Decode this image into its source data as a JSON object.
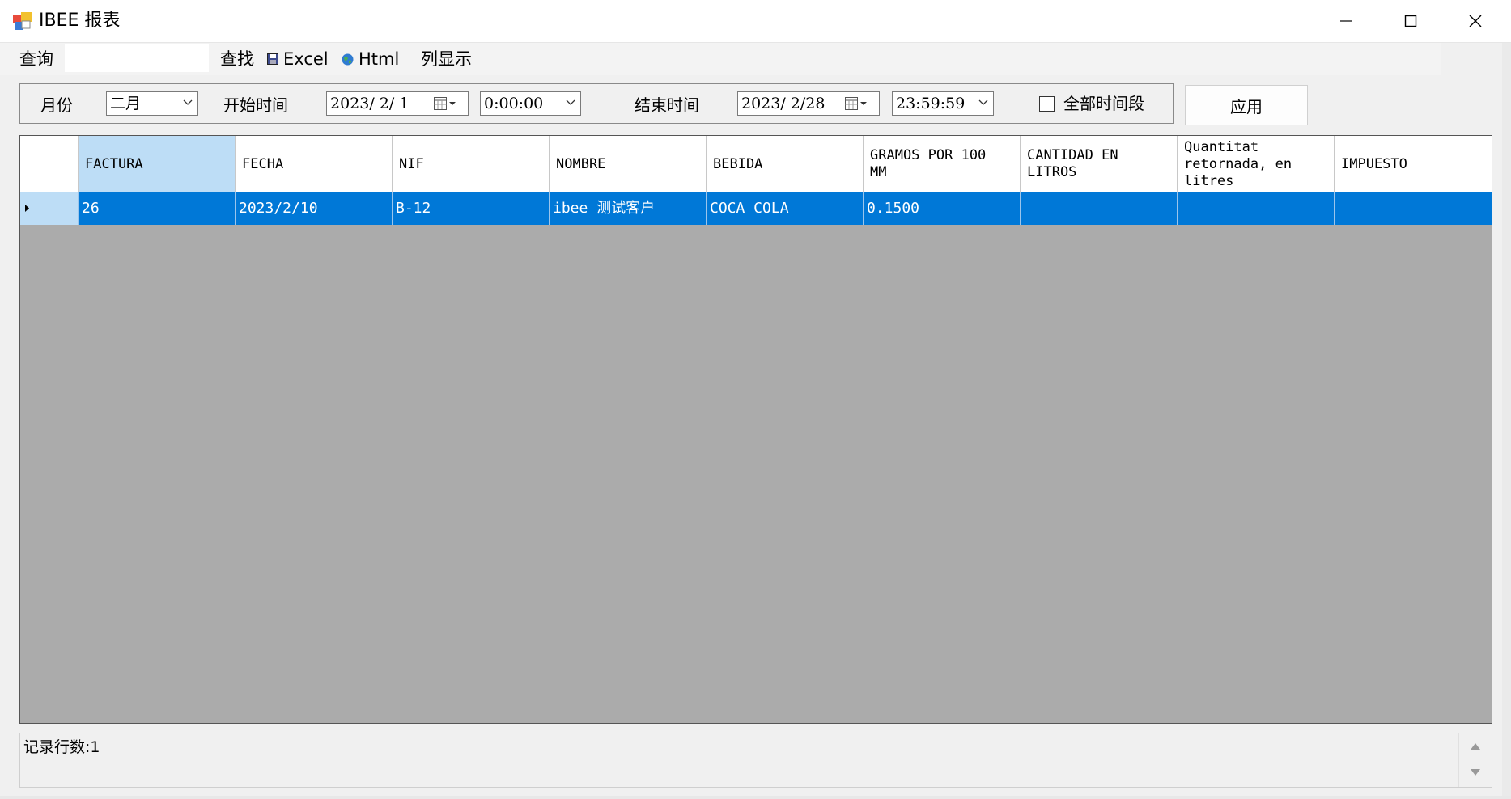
{
  "window": {
    "title": "IBEE 报表",
    "minimize_icon": "minimize-icon",
    "maximize_icon": "maximize-icon",
    "close_icon": "close-icon"
  },
  "toolbar": {
    "query_label": "查询",
    "search_value": "",
    "find_label": "查找",
    "excel_label": "Excel",
    "html_label": "Html",
    "columns_label": "列显示"
  },
  "filter": {
    "month_label": "月份",
    "month_value": "二月",
    "start_label": "开始时间",
    "start_date": "2023/ 2/ 1",
    "start_time": "0:00:00",
    "end_label": "结束时间",
    "end_date": "2023/ 2/28",
    "end_time": "23:59:59",
    "all_periods_label": "全部时间段",
    "all_periods_checked": false,
    "apply_label": "应用"
  },
  "grid": {
    "columns": [
      "FACTURA",
      "FECHA",
      "NIF",
      "NOMBRE",
      "BEBIDA",
      "GRAMOS POR 100\nMM",
      "CANTIDAD EN\nLITROS",
      "Quantitat\nretornada, en\nlitres",
      "IMPUESTO"
    ],
    "rows": [
      [
        "26",
        "2023/2/10",
        "B-12",
        "ibee 测试客户",
        "COCA COLA",
        "0.1500",
        "",
        "",
        ""
      ]
    ],
    "selected_header_color": "#bdddf6",
    "selected_row_color": "#0078d7"
  },
  "status": {
    "text": "记录行数:1"
  }
}
